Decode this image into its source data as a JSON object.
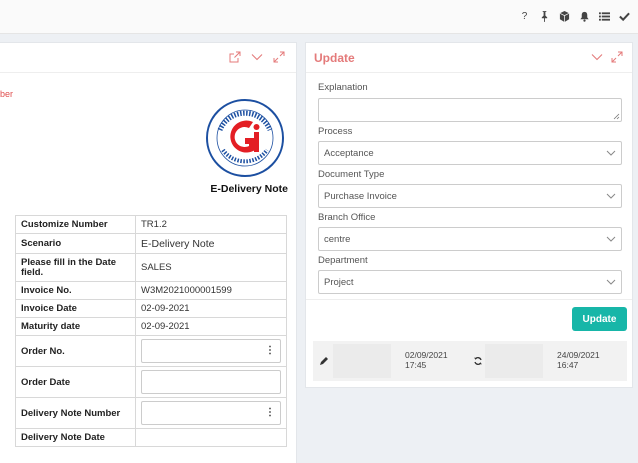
{
  "topbar": {
    "icons": [
      "question-icon",
      "pin-icon",
      "cube-icon",
      "bell-icon",
      "list-icon",
      "check-icon"
    ],
    "help_glyph": "?"
  },
  "left_panel": {
    "note_fragment": "ber",
    "document_title": "E-Delivery Note",
    "fields": [
      {
        "label": "Customize Number",
        "value": "TR1.2"
      },
      {
        "label": "Scenario",
        "value": "E-Delivery Note"
      },
      {
        "label": "Please fill in the Date field.",
        "value": "SALES"
      },
      {
        "label": "Invoice No.",
        "value": "W3M2021000001599"
      },
      {
        "label": "Invoice Date",
        "value": "02-09-2021"
      },
      {
        "label": "Maturity date",
        "value": "02-09-2021"
      },
      {
        "label": "Order No.",
        "value": ""
      },
      {
        "label": "Order Date",
        "value": ""
      },
      {
        "label": "Delivery Note Number",
        "value": ""
      },
      {
        "label": "Delivery Note Date",
        "value": ""
      }
    ]
  },
  "update_panel": {
    "title": "Update",
    "explanation_label": "Explanation",
    "explanation_value": "",
    "process_label": "Process",
    "process_value": "Acceptance",
    "document_type_label": "Document Type",
    "document_type_value": "Purchase Invoice",
    "branch_office_label": "Branch Office",
    "branch_office_value": "centre",
    "department_label": "Department",
    "department_value": "Project",
    "update_button": "Update",
    "history": {
      "created_date": "02/09/2021",
      "created_time": "17:45",
      "updated_date": "24/09/2021",
      "updated_time": "16:47"
    }
  },
  "colors": {
    "accent_teal": "#17b6a8",
    "panel_title": "#e47a7a",
    "logo_red": "#e31e24",
    "logo_blue": "#1c4fa1"
  }
}
